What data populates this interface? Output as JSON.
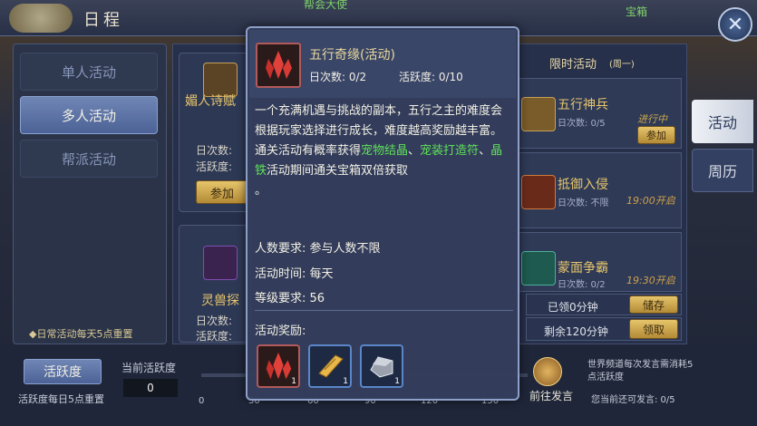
{
  "header": {
    "title": "日程"
  },
  "bg_labels": {
    "left": "帮会大使",
    "right": "宝箱"
  },
  "left_nav": [
    {
      "label": "单人活动"
    },
    {
      "label": "多人活动"
    },
    {
      "label": "帮派活动"
    }
  ],
  "left_notice": "◆日常活动每天5点重置",
  "cards": [
    {
      "name": "媚人诗赋",
      "stat1": "日次数:",
      "stat2": "活跃度:",
      "button": "参加"
    },
    {
      "name": "灵兽探",
      "stat1": "日次数:",
      "stat2": "活跃度:"
    }
  ],
  "right_panel": {
    "header": "限时活动",
    "header_sub": "(周一)",
    "items": [
      {
        "name": "五行神兵",
        "sub": "日次数: 0/5",
        "status": "进行中",
        "button": "参加"
      },
      {
        "name": "抵御入侵",
        "sub": "日次数: 不限",
        "time": "19:00开启"
      },
      {
        "name": "蒙面争霸",
        "sub": "日次数: 0/2",
        "time": "19:30开启"
      }
    ],
    "store_rows": [
      {
        "label": "已领0分钟",
        "button": "储存"
      },
      {
        "label": "剩余120分钟",
        "button": "领取"
      }
    ]
  },
  "side_tabs": [
    {
      "label": "活动"
    },
    {
      "label": "周历"
    }
  ],
  "bottom": {
    "activity_button": "活跃度",
    "activity_note": "活跃度每日5点重置",
    "current_label": "当前活跃度",
    "current_value": "0",
    "ticks": [
      "0",
      "30",
      "60",
      "90",
      "120",
      "150"
    ],
    "chat_button": "前往发言",
    "chat_note": "世界频道每次发言需消耗5点活跃度",
    "chat_remaining": "您当前还可发言: 0/5"
  },
  "tooltip": {
    "title": "五行奇缘(活动)",
    "daily_count": "日次数: 0/2",
    "activity": "活跃度: 0/10",
    "desc_1": "一个充满机遇与挑战的副本，五行之主的难度会根据玩家选择进行成长，难度越高奖励越丰富。通关活动有概率获得",
    "desc_green_1": "宠物结晶",
    "desc_sep_1": "、",
    "desc_green_2": "宠装打造符",
    "desc_sep_2": "、",
    "desc_green_3": "晶铁",
    "desc_2": "活动期间通关宝箱双倍获取",
    "desc_end": "。",
    "req_people": "人数要求: 参与人数不限",
    "req_time": "活动时间: 每天",
    "req_level": "等级要求: 56",
    "reward_label": "活动奖励:",
    "rewards": [
      {
        "icon": "red-crystal-icon",
        "count": "1",
        "border": "#b25a5a"
      },
      {
        "icon": "gold-scroll-icon",
        "count": "1",
        "border": "#5a86c8"
      },
      {
        "icon": "iron-ore-icon",
        "count": "1",
        "border": "#5a86c8"
      }
    ]
  }
}
